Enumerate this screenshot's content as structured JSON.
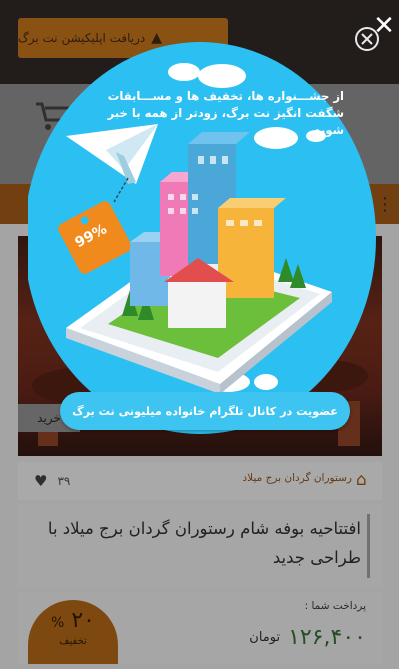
{
  "topbar": {
    "app_button_label": "دریافت اپلیکیشن نت برگ",
    "android_icon": "android-icon"
  },
  "header": {
    "cart_icon": "cart-icon",
    "menu_icon": "hamburger-icon"
  },
  "deal": {
    "buy_label": "خرید",
    "venue": "رستوران گردان برج میلاد",
    "likes_count": "۳۹",
    "title": "افتتاحیه بوفه شام رستوران گردان برج میلاد با طراحی جدید",
    "payment_hint": "پرداخت شما :",
    "price": "۱۲۶,۴۰۰",
    "currency": "تومان",
    "discount_value": "۲۰",
    "discount_percent": "%",
    "discount_label": "تخفیف"
  },
  "popup": {
    "heading_line1": "از جشـــنواره ها، تخفیف ها و مســـابقات",
    "heading_line2": "شگفت انگیز نت برگ، زودتر از همه با خبر شوید",
    "tag_percent": "99%",
    "cta_label": "عضویت در کانال تلگرام خانواده میلیونی نت برگ",
    "close_icon": "close-icon"
  },
  "colors": {
    "bubble": "#2cc0f2",
    "cta": "#3ec4f0",
    "orange": "#f08a1c",
    "price_green": "#2e5e2e"
  }
}
